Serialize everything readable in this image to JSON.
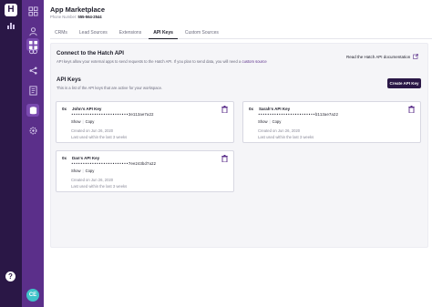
{
  "app": {
    "logo_letter": "H",
    "title": "App Marketplace",
    "phone_label": "Phone Number:",
    "phone_number": "555-564-2544"
  },
  "sidebar": {
    "help_label": "?",
    "avatar_initials": "CE",
    "rail_icons": [
      "grid-icon",
      "user-icon",
      "link-icon",
      "share-icon",
      "document-icon",
      "database-icon",
      "settings-icon"
    ],
    "top_icons": [
      "apps-icon",
      "chart-icon"
    ]
  },
  "tabs": [
    {
      "label": "CRMs",
      "active": false
    },
    {
      "label": "Lead Sources",
      "active": false
    },
    {
      "label": "Extensions",
      "active": false
    },
    {
      "label": "API Keys",
      "active": true
    },
    {
      "label": "Custom Sources",
      "active": false
    }
  ],
  "connect": {
    "title": "Connect to the Hatch API",
    "description": "API keys allow your external apps to send requests to the Hatch API. If you plan to send data, you will need a",
    "description_link": "custom source",
    "doc_link": "Read the Hatch API documentation"
  },
  "keys_section": {
    "title": "API Keys",
    "description": "This is a list of the API keys that are active for your workspace.",
    "create_button": "Create API Key"
  },
  "cards": [
    {
      "icon": "0x",
      "name": "John's API Key",
      "key": "•••••••••••••••••••••••••3e113ae7a22",
      "show": "Show",
      "copy": "Copy",
      "created": "Created on Jun 26, 2020",
      "last_used": "Last used within the last 3 weeks"
    },
    {
      "icon": "0x",
      "name": "Sarah's API Key",
      "key": "•••••••••••••••••••••••••b113ae7a22",
      "show": "Show",
      "copy": "Copy",
      "created": "Created on Jun 26, 2020",
      "last_used": "Last used within the last 3 weeks"
    },
    {
      "icon": "0x",
      "name": "Dan's API Key",
      "key": "•••••••••••••••••••••••••7ee243bd7a22",
      "show": "Show",
      "copy": "Copy",
      "created": "Created on Jun 26, 2020",
      "last_used": "Last used within the last 3 weeks"
    }
  ],
  "colors": {
    "rail_dark": "#2a1746",
    "rail_purple": "#5b2f8a",
    "accent": "#5b2f8a",
    "avatar": "#3fc3c9",
    "trash": "#5b2f8a"
  }
}
